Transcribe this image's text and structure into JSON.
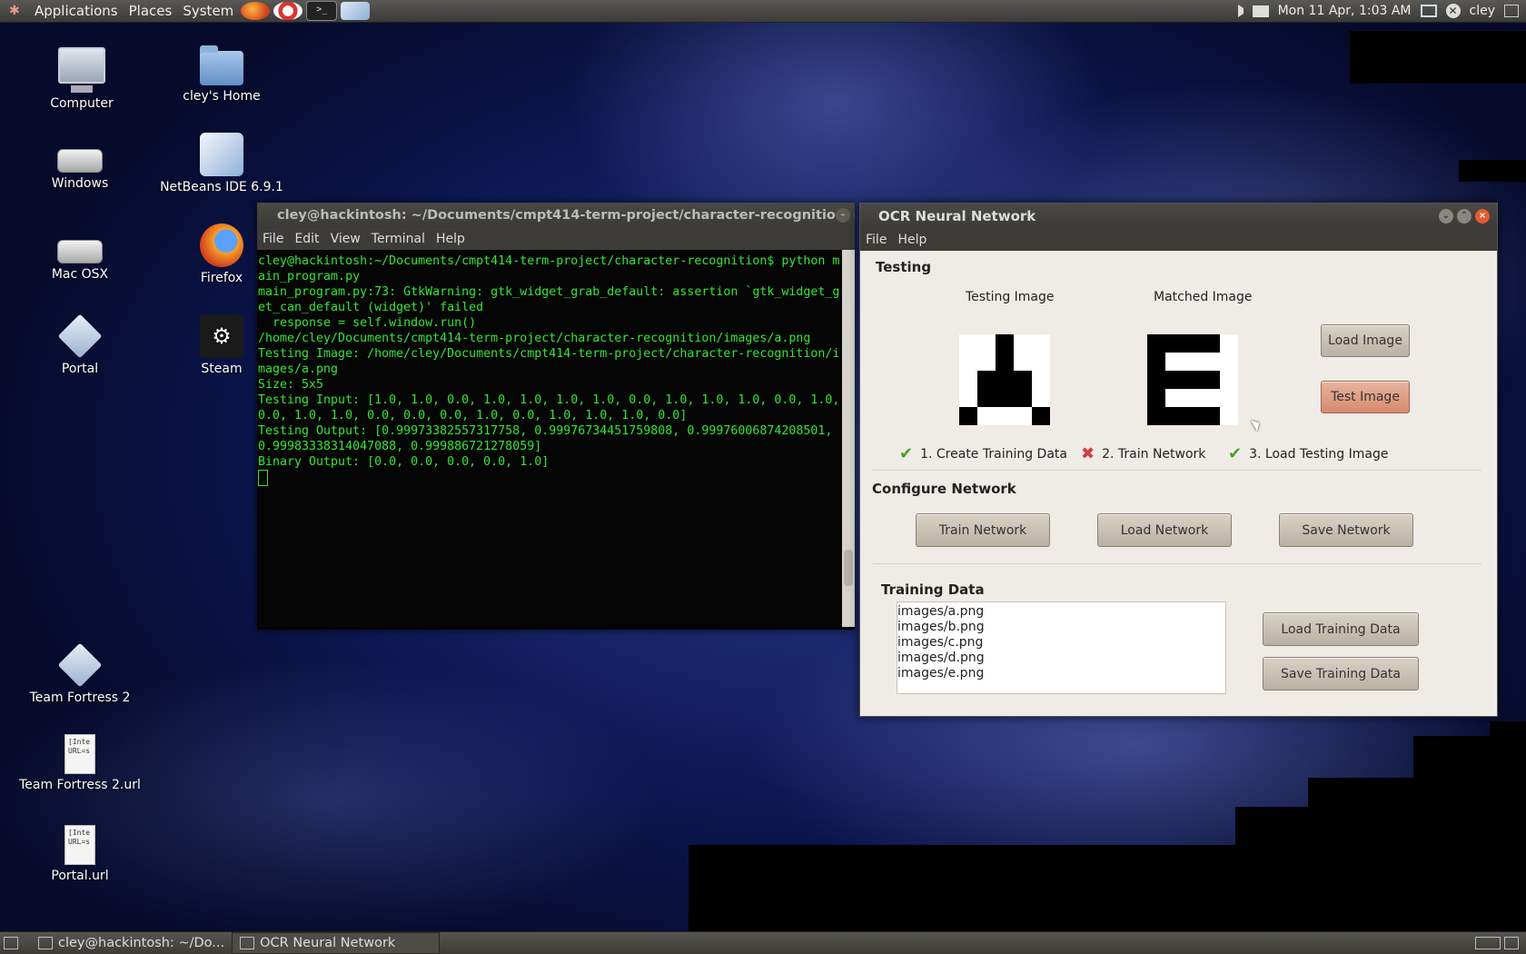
{
  "top_panel": {
    "menus": [
      "Applications",
      "Places",
      "System"
    ],
    "clock": "Mon 11 Apr,  1:03 AM",
    "user": "cley"
  },
  "desktop_icons": [
    {
      "label": "Computer"
    },
    {
      "label": "cley's Home"
    },
    {
      "label": "Windows"
    },
    {
      "label": "NetBeans IDE 6.9.1"
    },
    {
      "label": "Mac OSX"
    },
    {
      "label": "Firefox"
    },
    {
      "label": "Portal"
    },
    {
      "label": "Steam"
    },
    {
      "label": "Team Fortress 2"
    },
    {
      "label": "Team Fortress 2.url",
      "preview": "[Inte\nURL=s"
    },
    {
      "label": "Portal.url",
      "preview": "[Inte\nURL=s"
    }
  ],
  "terminal": {
    "title": "cley@hackintosh: ~/Documents/cmpt414-term-project/character-recognitio",
    "menus": [
      "File",
      "Edit",
      "View",
      "Terminal",
      "Help"
    ],
    "output": "cley@hackintosh:~/Documents/cmpt414-term-project/character-recognition$ python main_program.py\nmain_program.py:73: GtkWarning: gtk_widget_grab_default: assertion `gtk_widget_get_can_default (widget)' failed\n  response = self.window.run()\n/home/cley/Documents/cmpt414-term-project/character-recognition/images/a.png\nTesting Image: /home/cley/Documents/cmpt414-term-project/character-recognition/images/a.png\nSize: 5x5\nTesting Input: [1.0, 1.0, 0.0, 1.0, 1.0, 1.0, 1.0, 0.0, 1.0, 1.0, 1.0, 0.0, 1.0, 0.0, 1.0, 1.0, 0.0, 0.0, 0.0, 1.0, 0.0, 1.0, 1.0, 1.0, 0.0]\nTesting Output: [0.99973382557317758, 0.99976734451759808, 0.99976006874208501, 0.99983338314047088, 0.999886721278059]\nBinary Output: [0.0, 0.0, 0.0, 0.0, 1.0]\n"
  },
  "ocr": {
    "title": "OCR Neural Network",
    "menus": [
      "File",
      "Help"
    ],
    "testing": {
      "section": "Testing",
      "testing_image_label": "Testing Image",
      "matched_image_label": "Matched Image",
      "load_image": "Load Image",
      "test_image": "Test Image",
      "testing_pixels": [
        1,
        1,
        0,
        1,
        1,
        1,
        1,
        0,
        1,
        1,
        1,
        0,
        0,
        0,
        1,
        1,
        0,
        0,
        0,
        1,
        0,
        1,
        1,
        1,
        0
      ],
      "matched_pixels": [
        0,
        0,
        0,
        0,
        1,
        0,
        1,
        1,
        1,
        1,
        0,
        0,
        0,
        0,
        1,
        0,
        1,
        1,
        1,
        1,
        0,
        0,
        0,
        0,
        1
      ],
      "steps": [
        {
          "label": "1. Create Training Data",
          "state": "ok"
        },
        {
          "label": "2. Train Network",
          "state": "fail"
        },
        {
          "label": "3. Load Testing Image",
          "state": "ok"
        }
      ]
    },
    "configure": {
      "section": "Configure Network",
      "train": "Train Network",
      "load": "Load Network",
      "save": "Save Network"
    },
    "training": {
      "section": "Training Data",
      "files": [
        "images/a.png",
        "images/b.png",
        "images/c.png",
        "images/d.png",
        "images/e.png"
      ],
      "load": "Load Training Data",
      "save": "Save Training Data"
    }
  },
  "taskbar": {
    "tasks": [
      "cley@hackintosh: ~/Do...",
      "OCR Neural Network"
    ]
  }
}
